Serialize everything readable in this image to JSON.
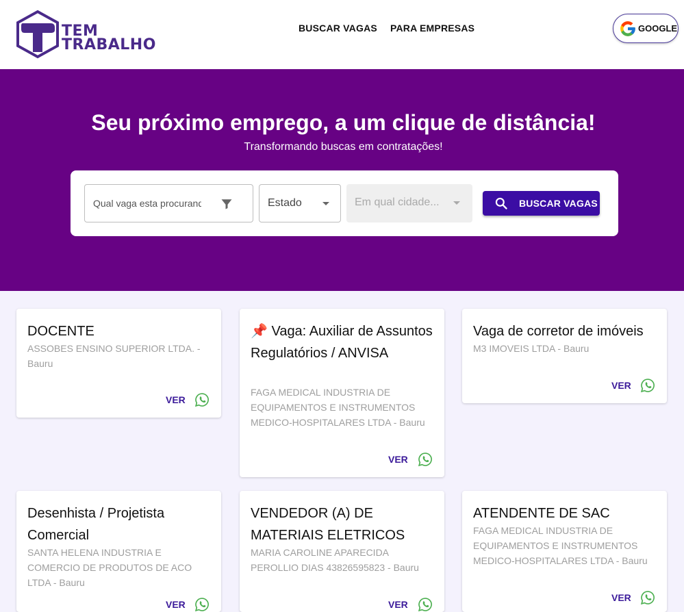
{
  "header": {
    "logo_line1": "TEM",
    "logo_line2": "TRABALHO",
    "nav": [
      "BUSCAR VAGAS",
      "PARA EMPRESAS"
    ],
    "google_label": "GOOGLE"
  },
  "hero": {
    "title": "Seu próximo emprego, a um clique de distância!",
    "subtitle": "Transformando buscas em contratações!"
  },
  "search": {
    "query_placeholder": "Qual vaga esta procurando?",
    "state_value": "Estado",
    "city_placeholder": "Em qual cidade...",
    "button_label": "BUSCAR VAGAS"
  },
  "colors": {
    "hero_bg": "#670284",
    "primary": "#3b0da4",
    "whatsapp": "#4caf50"
  },
  "cards": [
    {
      "title": "DOCENTE",
      "company": "ASSOBES ENSINO SUPERIOR LTDA. - Bauru",
      "ver": "VER"
    },
    {
      "title": "📌 Vaga: Auxiliar de Assuntos Regulatórios / ANVISA",
      "company": "FAGA MEDICAL INDUSTRIA DE EQUIPAMENTOS E INSTRUMENTOS MEDICO-HOSPITALARES LTDA - Bauru",
      "ver": "VER"
    },
    {
      "title": "Vaga de corretor de imóveis",
      "company": "M3 IMOVEIS LTDA - Bauru",
      "ver": "VER"
    },
    {
      "title": "Desenhista / Projetista Comercial",
      "company": "SANTA HELENA INDUSTRIA E COMERCIO DE PRODUTOS DE ACO LTDA - Bauru",
      "ver": "VER"
    },
    {
      "title": "VENDEDOR (A) DE MATERIAIS ELETRICOS",
      "company": "MARIA CAROLINE APARECIDA PEROLLIO DIAS 43826595823 - Bauru",
      "ver": "VER"
    },
    {
      "title": "ATENDENTE DE SAC",
      "company": "FAGA MEDICAL INDUSTRIA DE EQUIPAMENTOS E INSTRUMENTOS MEDICO-HOSPITALARES LTDA - Bauru",
      "ver": "VER"
    }
  ]
}
